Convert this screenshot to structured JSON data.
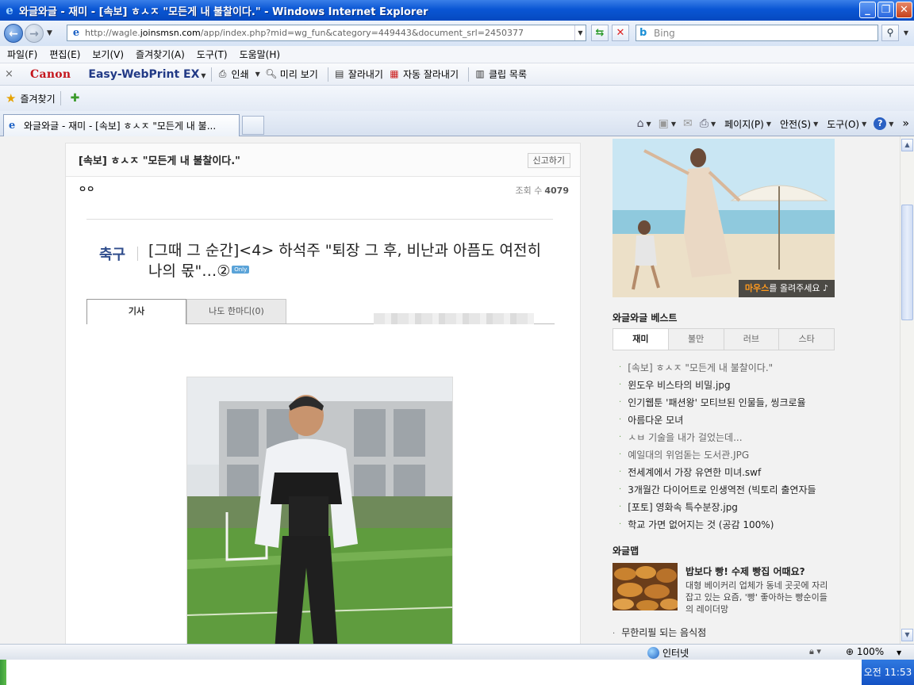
{
  "window": {
    "title": "와글와글 - 재미 - [속보] ㅎㅅㅈ \"모든게 내 불찰이다.\" - Windows Internet Explorer"
  },
  "address": {
    "url_prefix": "http://wagle.",
    "url_domain": "joinsmsn.com",
    "url_path": "/app/index.php?mid=wg_fun&category=449443&document_srl=2450377",
    "search_placeholder": "Bing"
  },
  "menu": [
    "파일(F)",
    "편집(E)",
    "보기(V)",
    "즐겨찾기(A)",
    "도구(T)",
    "도움말(H)"
  ],
  "canon_toolbar": {
    "close": "×",
    "canon": "Canon",
    "easy": "Easy-WebPrint EX",
    "print": "인쇄",
    "preview": "미리 보기",
    "clip": "잘라내기",
    "auto_clip": "자동 잘라내기",
    "clip_list": "클립 목록"
  },
  "favorites": {
    "label": "즐겨찾기"
  },
  "tab": {
    "title": "와글와글 - 재미 - [속보] ㅎㅅㅈ \"모든게 내 불..."
  },
  "command_bar": {
    "page": "페이지(P)",
    "safety": "안전(S)",
    "tools": "도구(O)",
    "more": "»"
  },
  "article": {
    "title": "[속보] ㅎㅅㅈ \"모든게 내 불찰이다.\"",
    "report_button": "신고하기",
    "author": "ㅇㅇ",
    "views_label": "조회 수",
    "views_count": "4079",
    "news_category": "축구",
    "news_title": "[그때 그 순간]<4> 하석주 \"퇴장 그 후, 비난과 아픔도 여전히 나의 몫\"…②",
    "news_badge": "Only",
    "tabs": [
      "기사",
      "나도 한마디(0)"
    ]
  },
  "sidebar": {
    "promo_caption_highlight": "마우스",
    "promo_caption_rest": "를 올려주세요 ♪",
    "best_title": "와글와글 베스트",
    "best_tabs": [
      "재미",
      "불만",
      "러브",
      "스타"
    ],
    "best_items": [
      "[속보] ㅎㅅㅈ \"모든게 내 불찰이다.\"",
      "윈도우 비스타의 비밀.jpg",
      "인기웹툰 '패션왕' 모티브된 인물들, 씽크로율",
      "아름다운 모녀",
      "ㅅㅂ 기술을 내가 걸었는데...",
      "예일대의 위엄돋는 도서관.JPG",
      "전세계에서 가장 유연한 미녀.swf",
      "3개월간 다이어트로 인생역전 (빅토리 출연자들",
      "[포토] 영화속 특수분장.jpg",
      "학교 가면 없어지는 것 (공감 100%)"
    ],
    "wagle_map_title": "와글맵",
    "wagle_map_headline": "밥보다 빵! 수제 빵집 어때요?",
    "wagle_map_desc": "대형 베이커리 업체가 동네 곳곳에 자리잡고 있는 요즘, '빵' 좋아하는 빵순이들의 레이더망",
    "wagle_map_more": "무한리필 되는 음식점"
  },
  "status": {
    "zone": "인터넷",
    "zoom": "100%"
  },
  "taskbar": {
    "clock": "오전 11:53"
  }
}
